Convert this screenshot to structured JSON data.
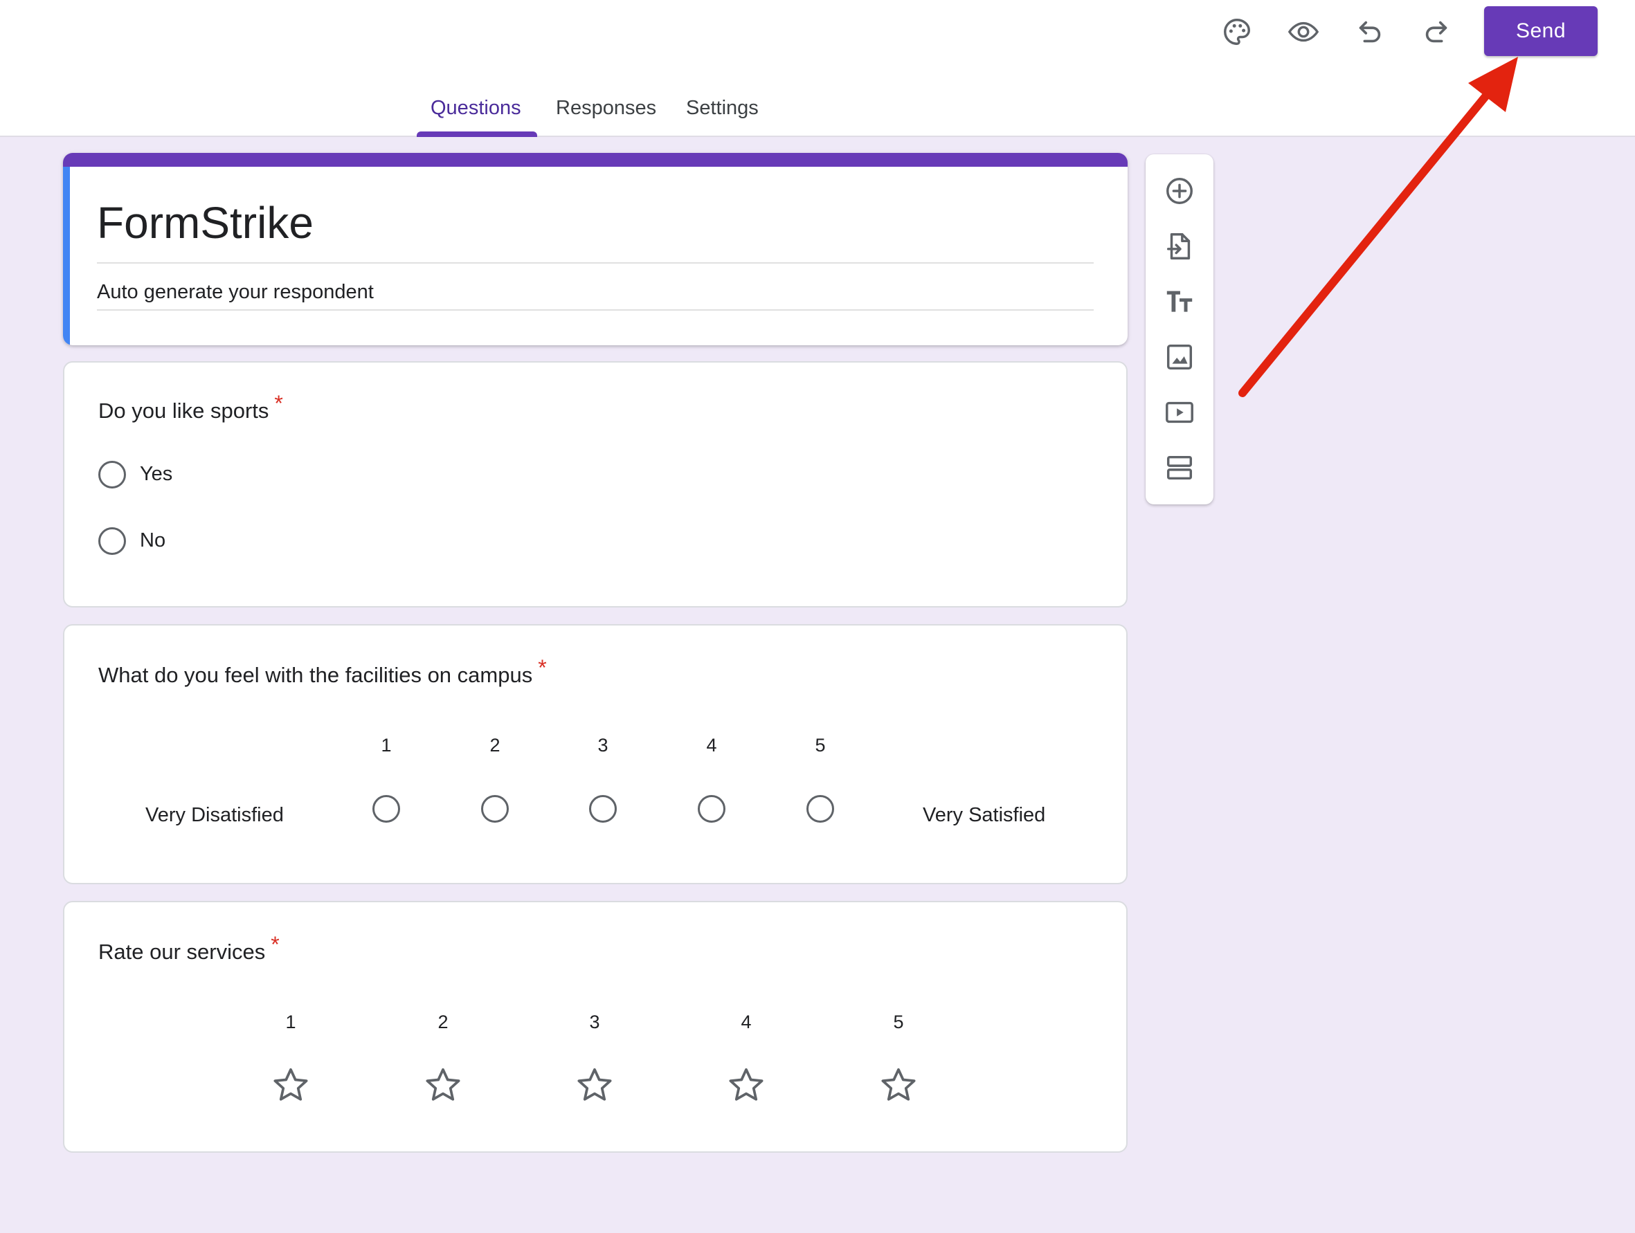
{
  "header": {
    "icons": [
      "palette-icon",
      "eye-preview-icon",
      "undo-icon",
      "redo-icon"
    ],
    "send_label": "Send",
    "accent_color": "#673ab7"
  },
  "tabs": [
    {
      "label": "Questions",
      "active": true
    },
    {
      "label": "Responses",
      "active": false
    },
    {
      "label": "Settings",
      "active": false
    }
  ],
  "form": {
    "title": "FormStrike",
    "description": "Auto generate your respondent"
  },
  "questions": [
    {
      "type": "multiple_choice",
      "title": "Do you like sports",
      "required_mark": "*",
      "options": [
        "Yes",
        "No"
      ]
    },
    {
      "type": "linear_scale",
      "title": "What do you feel with the facilities on campus",
      "required_mark": "*",
      "scale": [
        "1",
        "2",
        "3",
        "4",
        "5"
      ],
      "low_label": "Very Disatisfied",
      "high_label": "Very Satisfied"
    },
    {
      "type": "rating",
      "title": "Rate our services",
      "required_mark": "*",
      "scale": [
        "1",
        "2",
        "3",
        "4",
        "5"
      ]
    }
  ],
  "side_toolbar": {
    "tools": [
      "add-question-icon",
      "import-questions-icon",
      "add-title-icon",
      "add-image-icon",
      "add-video-icon",
      "add-section-icon"
    ]
  },
  "annotation": {
    "arrow_color": "#e3230f",
    "points_to": "send-button"
  }
}
